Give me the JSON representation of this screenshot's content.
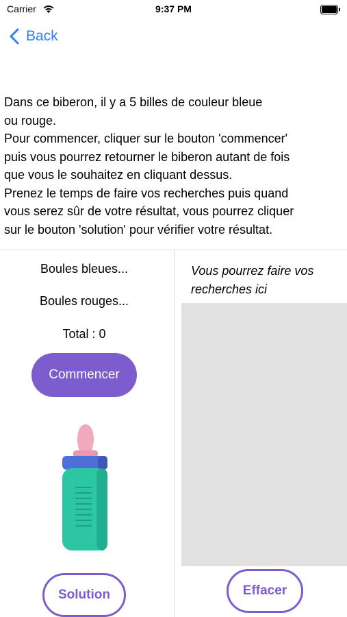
{
  "status_bar": {
    "carrier": "Carrier",
    "time": "9:37 PM"
  },
  "nav": {
    "back_label": "Back",
    "accent_color": "#2f7cf6"
  },
  "intro": {
    "text": "Dans ce biberon, il y a 5 billes de couleur bleue\nou rouge.\nPour commencer, cliquer sur le bouton 'commencer'\npuis vous pourrez retourner le biberon autant de fois\nque vous le souhaitez en cliquant dessus.\nPrenez le temps de faire vos recherches puis quand\nvous serez sûr de votre résultat, vous pourrez cliquer\nsur le bouton 'solution' pour vérifier votre résultat."
  },
  "counters": {
    "blue": "Boules bleues...",
    "red": "Boules rouges...",
    "total": "Total : 0"
  },
  "buttons": {
    "start": "Commencer",
    "solution": "Solution",
    "clear": "Effacer",
    "primary_color": "#7d5ccd"
  },
  "bottle": {
    "icon": "baby-bottle-icon"
  },
  "notes": {
    "hint": "Vous pourrez faire vos recherches ici",
    "value": ""
  }
}
